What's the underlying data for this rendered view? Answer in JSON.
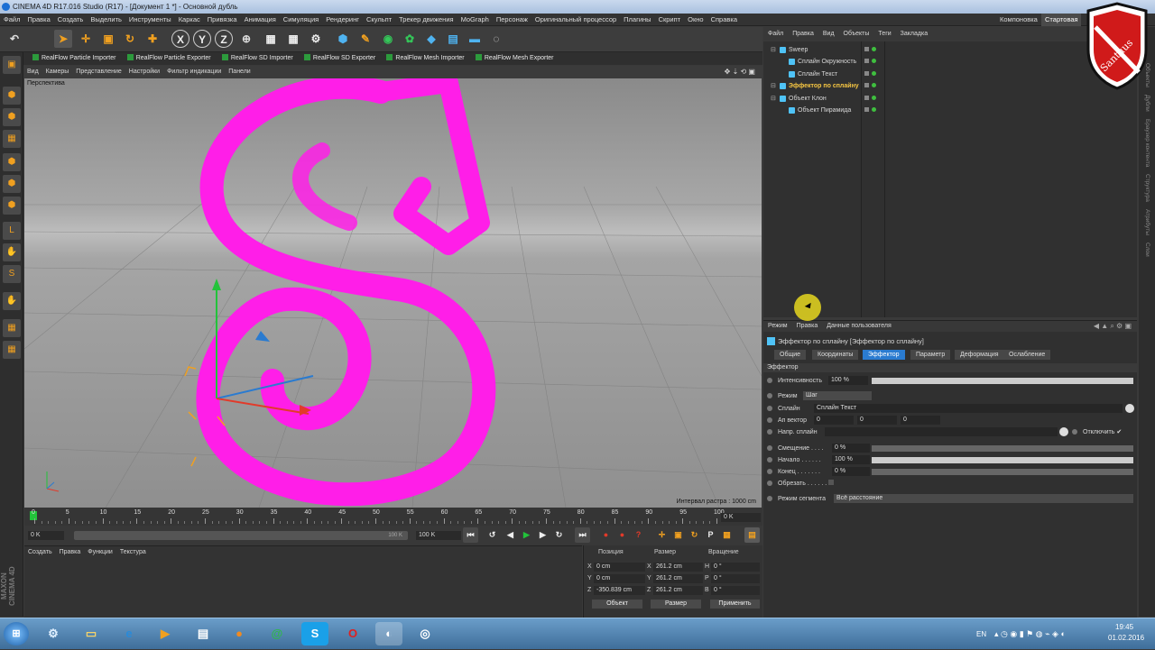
{
  "window": {
    "title": "CINEMA 4D R17.016 Studio (R17) - [Документ 1 *] - Основной дубль"
  },
  "menu": {
    "items": [
      "Файл",
      "Правка",
      "Создать",
      "Выделить",
      "Инструменты",
      "Каркас",
      "Привязка",
      "Анимация",
      "Симуляция",
      "Рендеринг",
      "Скульпт",
      "Трекер движения",
      "MoGraph",
      "Персонаж",
      "Оригинальный процессор",
      "Плагины",
      "Скрипт",
      "Окно",
      "Справка"
    ],
    "layout_label": "Компоновка",
    "layout_value": "Стартовая"
  },
  "toolbar": {
    "axis_x": "X",
    "axis_y": "Y",
    "axis_z": "Z"
  },
  "plugins": [
    "RealFlow Particle Importer",
    "RealFlow Particle Exporter",
    "RealFlow SD Importer",
    "RealFlow SD Exporter",
    "RealFlow Mesh Importer",
    "RealFlow Mesh Exporter"
  ],
  "viewport": {
    "menu": [
      "Вид",
      "Камеры",
      "Представление",
      "Настройки",
      "Фильтр индикации",
      "Панели"
    ],
    "label": "Перспектива",
    "raster": "Интервал растра : 1000 cm"
  },
  "timeline": {
    "ticks": [
      "0",
      "5",
      "10",
      "15",
      "20",
      "25",
      "30",
      "35",
      "40",
      "45",
      "50",
      "55",
      "60",
      "65",
      "70",
      "75",
      "80",
      "85",
      "90",
      "95",
      "100"
    ],
    "end_frame": "0 K",
    "start_field": "0 K",
    "range_end": "100 K",
    "max_field": "100 K"
  },
  "object_manager": {
    "menu": [
      "Создать",
      "Правка",
      "Функции",
      "Текстура"
    ]
  },
  "coords": {
    "headers": {
      "position": "Позиция",
      "size": "Размер",
      "rotation": "Вращение"
    },
    "rows": [
      {
        "axis": "X",
        "pos": "0 cm",
        "size_axis": "X",
        "size": "261.2 cm",
        "rot_axis": "H",
        "rot": "0 °"
      },
      {
        "axis": "Y",
        "pos": "0 cm",
        "size_axis": "Y",
        "size": "261.2 cm",
        "rot_axis": "P",
        "rot": "0 °"
      },
      {
        "axis": "Z",
        "pos": "-350.839 cm",
        "size_axis": "Z",
        "size": "261.2 cm",
        "rot_axis": "B",
        "rot": "0 °"
      }
    ],
    "mode": "Объект",
    "size_mode": "Размер",
    "apply": "Применить"
  },
  "branding": {
    "maxon": "MAXON CINEMA 4D",
    "logo_text": "Santuus"
  },
  "scene": {
    "menu": [
      "Файл",
      "Правка",
      "Вид",
      "Объекты",
      "Теги",
      "Закладка"
    ],
    "objects": [
      {
        "name": "Sweep",
        "depth": 0,
        "color": "#4fc3f7",
        "highlight": false
      },
      {
        "name": "Сплайн Окружность",
        "depth": 1,
        "color": "#4fc3f7",
        "highlight": false
      },
      {
        "name": "Сплайн Текст",
        "depth": 1,
        "color": "#4fc3f7",
        "highlight": false
      },
      {
        "name": "Эффектор по сплайну",
        "depth": 0,
        "color": "#4fc3f7",
        "highlight": true
      },
      {
        "name": "Объект Клон",
        "depth": 0,
        "color": "#4fc3f7",
        "highlight": false
      },
      {
        "name": "Объект Пирамида",
        "depth": 1,
        "color": "#4fc3f7",
        "highlight": false
      }
    ]
  },
  "attributes": {
    "menu": [
      "Режим",
      "Правка",
      "Данные пользователя"
    ],
    "title": "Эффектор по сплайну [Эффектор по сплайну]",
    "tabs": [
      "Общие",
      "Координаты",
      "Эффектор",
      "Параметр",
      "Деформация",
      "Ослабление"
    ],
    "active_tab": "Эффектор",
    "section": "Эффектор",
    "intensity_label": "Интенсивность",
    "intensity": "100 %",
    "mode_label": "Режим",
    "mode_value": "Шаг",
    "spline_label": "Сплайн",
    "spline_value": "Сплайн Текст",
    "upvector_label": "Ап вектор",
    "upvector": [
      "0",
      "0",
      "0"
    ],
    "rail_label": "Напр. сплайн",
    "disable_label": "Отключить",
    "offset_label": "Смещение",
    "offset": "0 %",
    "start_label": "Начало",
    "start": "100 %",
    "end_label": "Конец",
    "end": "0 %",
    "clip_label": "Обрезать",
    "segment_label": "Режим сегмента",
    "segment_value": "Всё расстояние"
  },
  "sidetabs": [
    "Объекты",
    "Дубли",
    "Браузер контента",
    "Структура",
    "Атрибуты",
    "Слои"
  ],
  "taskbar": {
    "lang": "EN",
    "time": "19:45",
    "date": "01.02.2016"
  },
  "colors": {
    "accent": "#2a7bd0",
    "shape": "#ff1ee8",
    "highlight_text": "#f5c542"
  }
}
